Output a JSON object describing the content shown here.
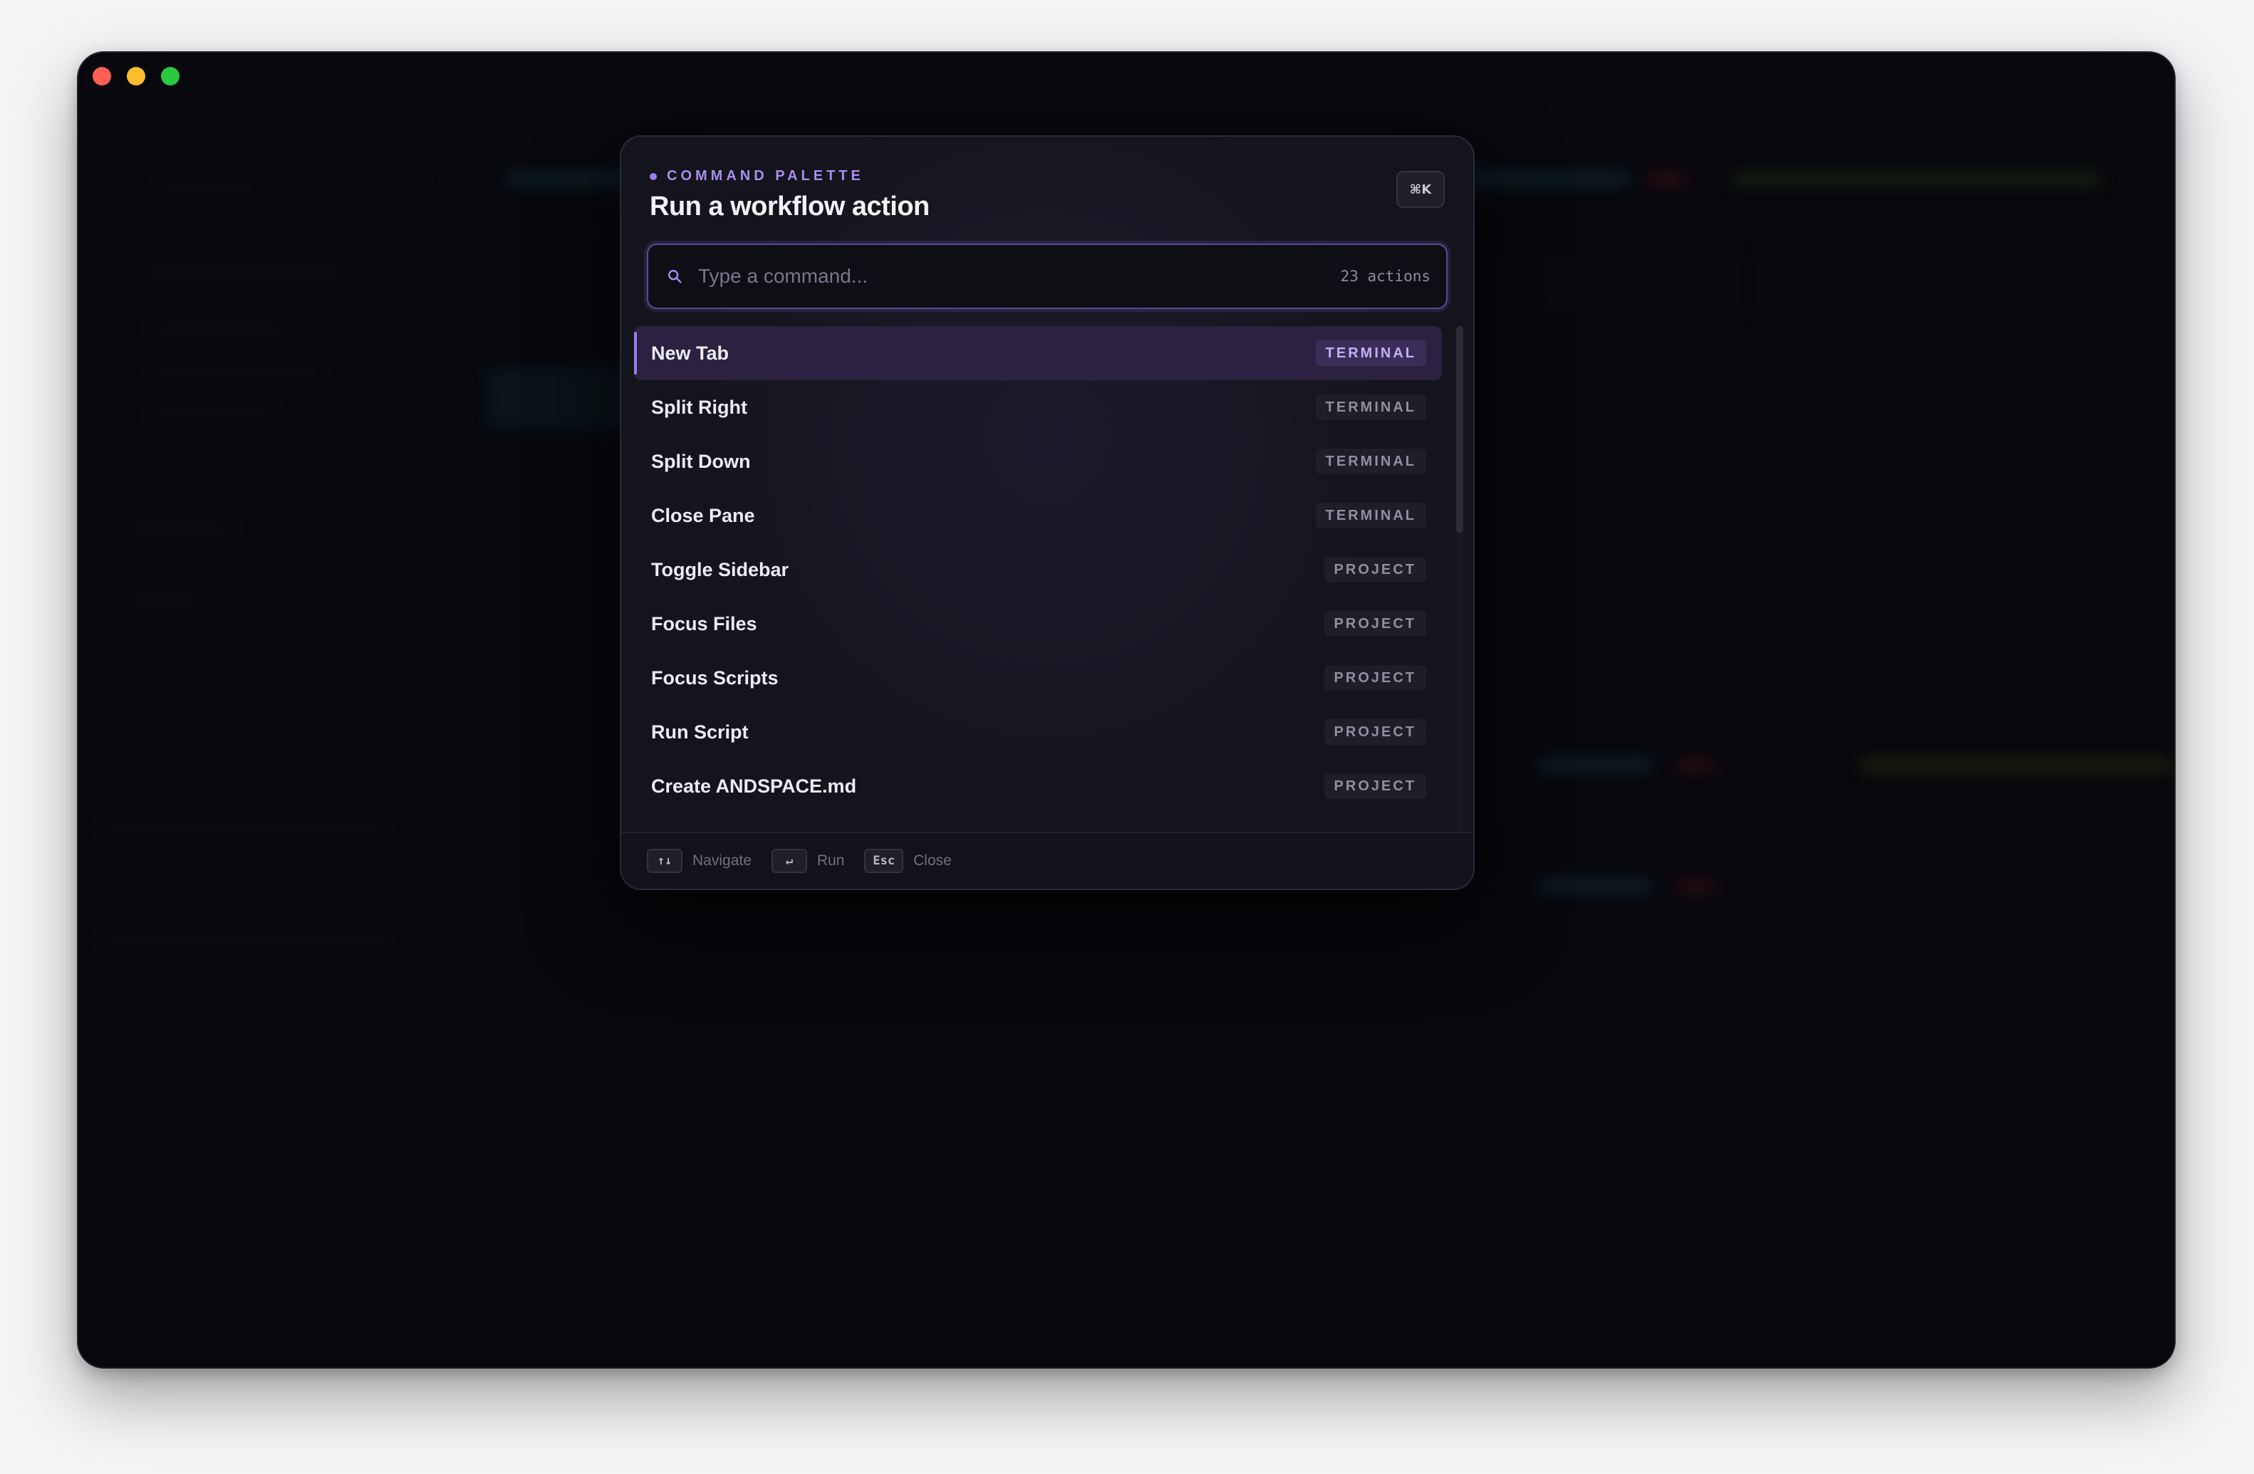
{
  "window": {
    "controls": [
      "close",
      "minimize",
      "zoom"
    ]
  },
  "palette": {
    "eyebrow": "COMMAND PALETTE",
    "title": "Run a workflow action",
    "shortcut": "⌘K",
    "search": {
      "placeholder": "Type a command...",
      "value": "",
      "count": "23 actions"
    },
    "items": [
      {
        "label": "New Tab",
        "tag": "TERMINAL",
        "active": true
      },
      {
        "label": "Split Right",
        "tag": "TERMINAL"
      },
      {
        "label": "Split Down",
        "tag": "TERMINAL"
      },
      {
        "label": "Close Pane",
        "tag": "TERMINAL"
      },
      {
        "label": "Toggle Sidebar",
        "tag": "PROJECT"
      },
      {
        "label": "Focus Files",
        "tag": "PROJECT"
      },
      {
        "label": "Focus Scripts",
        "tag": "PROJECT"
      },
      {
        "label": "Run Script",
        "tag": "PROJECT"
      },
      {
        "label": "Create ANDSPACE.md",
        "tag": "PROJECT"
      }
    ],
    "footer": {
      "navigate_key": "↑↓",
      "navigate_label": "Navigate",
      "run_key": "↵",
      "run_label": "Run",
      "close_key": "Esc",
      "close_label": "Close"
    }
  },
  "colors": {
    "accent": "#9b7cf0",
    "active_row": "#2a2240",
    "window_bg": "#0a0b10"
  },
  "icons": [
    "search-icon"
  ]
}
